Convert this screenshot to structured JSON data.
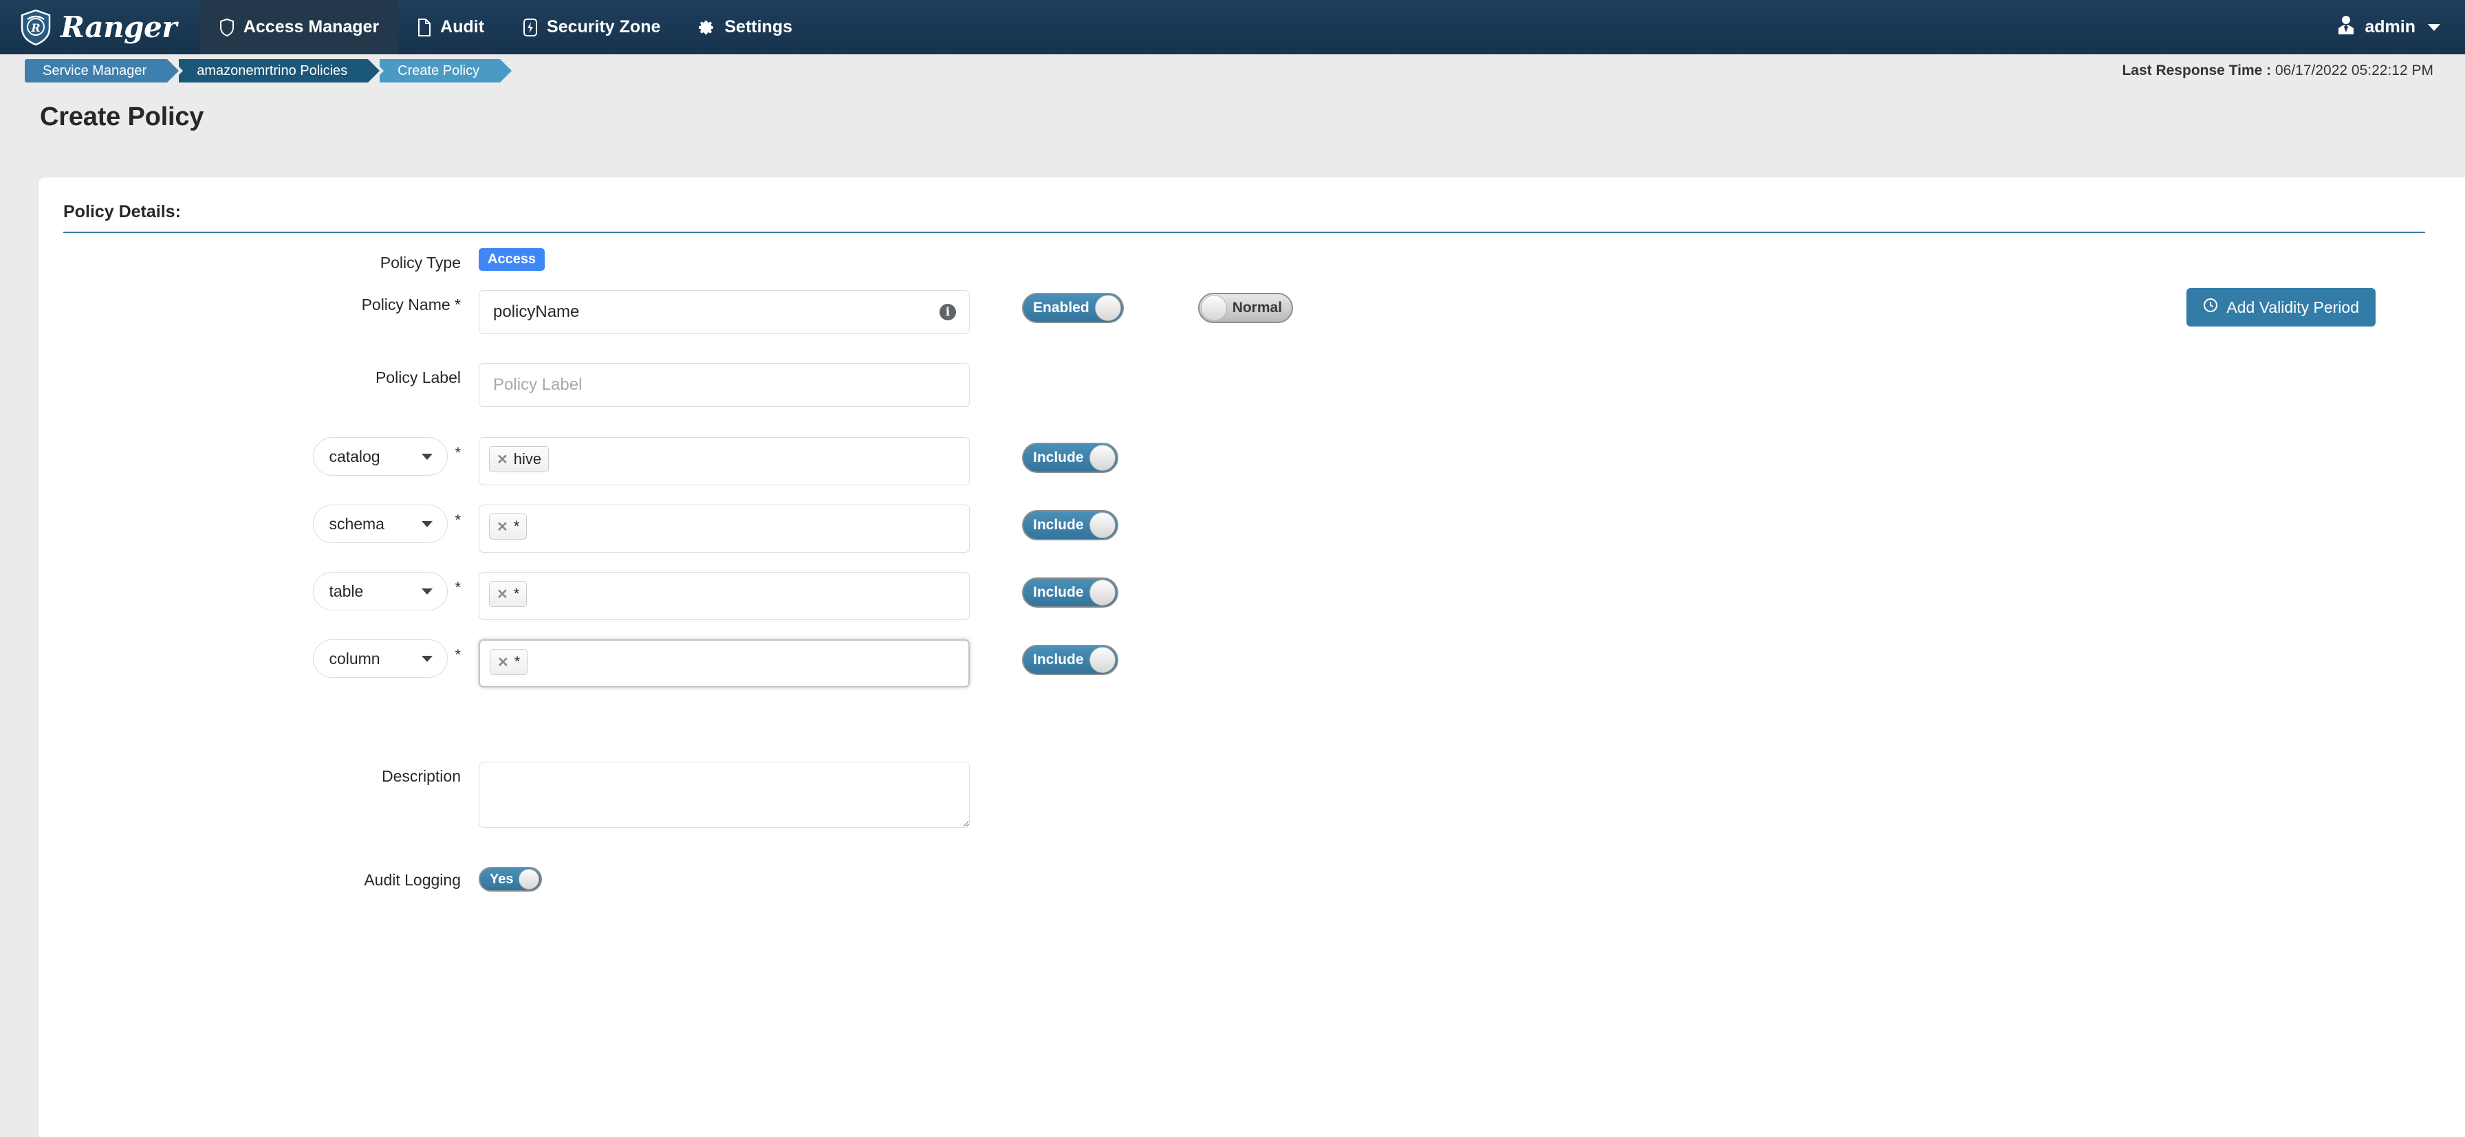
{
  "nav": {
    "brand": "Ranger",
    "items": [
      {
        "label": "Access Manager",
        "icon": "shield-icon",
        "active": true
      },
      {
        "label": "Audit",
        "icon": "file-icon",
        "active": false
      },
      {
        "label": "Security Zone",
        "icon": "bolt-icon",
        "active": false
      },
      {
        "label": "Settings",
        "icon": "gear-icon",
        "active": false
      }
    ],
    "user": "admin"
  },
  "breadcrumb": {
    "items": [
      "Service Manager",
      "amazonemrtrino Policies",
      "Create Policy"
    ]
  },
  "response": {
    "label": "Last Response Time :",
    "value": "06/17/2022 05:22:12 PM"
  },
  "page": {
    "title": "Create Policy"
  },
  "section": {
    "title": "Policy Details:"
  },
  "validity_button": {
    "label": "Add Validity Period",
    "icon": "clock-icon"
  },
  "form": {
    "policy_type": {
      "label": "Policy Type",
      "badge": "Access"
    },
    "policy_name": {
      "label": "Policy Name *",
      "value": "policyName",
      "placeholder": "Policy Name",
      "info_icon": "info-icon",
      "enabled_toggle": {
        "label": "Enabled",
        "state": "on"
      },
      "normal_toggle": {
        "label": "Normal",
        "state": "off"
      }
    },
    "policy_label": {
      "label": "Policy Label",
      "value": "",
      "placeholder": "Policy Label"
    },
    "resources": [
      {
        "select": "catalog",
        "options": [
          "catalog"
        ],
        "required": "*",
        "chips": [
          "hive"
        ],
        "toggle": {
          "label": "Include",
          "state": "on"
        },
        "focused": false
      },
      {
        "select": "schema",
        "options": [
          "schema"
        ],
        "required": "*",
        "chips": [
          "*"
        ],
        "toggle": {
          "label": "Include",
          "state": "on"
        },
        "focused": false
      },
      {
        "select": "table",
        "options": [
          "table"
        ],
        "required": "*",
        "chips": [
          "*"
        ],
        "toggle": {
          "label": "Include",
          "state": "on"
        },
        "focused": false
      },
      {
        "select": "column",
        "options": [
          "column"
        ],
        "required": "*",
        "chips": [
          "*"
        ],
        "toggle": {
          "label": "Include",
          "state": "on"
        },
        "focused": true
      }
    ],
    "description": {
      "label": "Description",
      "value": "",
      "placeholder": ""
    },
    "audit_logging": {
      "label": "Audit Logging",
      "toggle": {
        "label": "Yes",
        "state": "on"
      }
    }
  },
  "colors": {
    "navbar": "#1b3a57",
    "accent": "#3a7ca5",
    "badge": "#3f86f7",
    "toggle_on": "#3f86ae",
    "page_bg": "#ebebeb"
  }
}
